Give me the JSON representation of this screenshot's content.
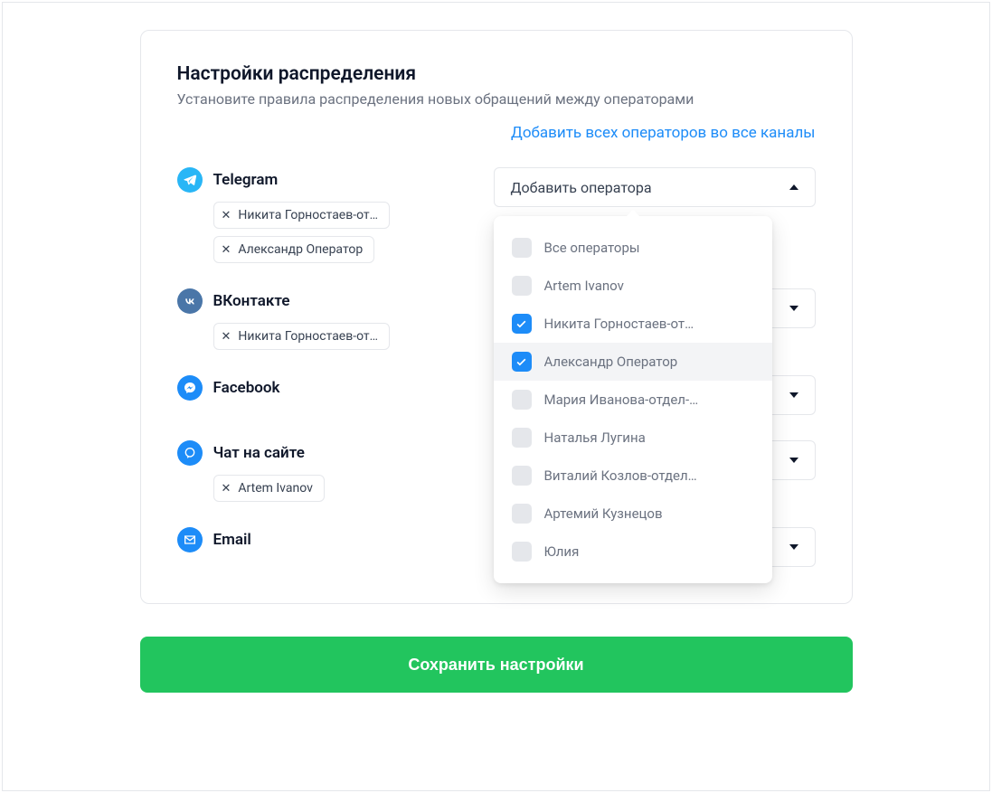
{
  "header": {
    "title": "Настройки распределения",
    "subtitle": "Установите правила распределения новых обращений между операторами",
    "add_all_link": "Добавить всех операторов во все каналы"
  },
  "select_placeholder": "Добавить оператора",
  "channels": [
    {
      "key": "telegram",
      "name": "Telegram",
      "icon": "telegram-icon",
      "dropdown_open": true,
      "operators": [
        "Никита Горностаев-от…",
        "Александр Оператор"
      ]
    },
    {
      "key": "vkontakte",
      "name": "ВКонтакте",
      "icon": "vk-icon",
      "dropdown_open": false,
      "operators": [
        "Никита Горностаев-от…"
      ]
    },
    {
      "key": "facebook",
      "name": "Facebook",
      "icon": "facebook-icon",
      "dropdown_open": false,
      "operators": []
    },
    {
      "key": "site_chat",
      "name": "Чат на сайте",
      "icon": "chat-icon",
      "dropdown_open": false,
      "operators": [
        "Artem Ivanov"
      ]
    },
    {
      "key": "email",
      "name": "Email",
      "icon": "email-icon",
      "dropdown_open": false,
      "operators": []
    }
  ],
  "dropdown": {
    "items": [
      {
        "label": "Все операторы",
        "checked": false
      },
      {
        "label": "Artem Ivanov",
        "checked": false
      },
      {
        "label": "Никита Горностаев-от…",
        "checked": true
      },
      {
        "label": "Александр Оператор",
        "checked": true,
        "hover": true
      },
      {
        "label": "Мария Иванова-отдел-…",
        "checked": false
      },
      {
        "label": "Наталья Лугина",
        "checked": false
      },
      {
        "label": "Виталий Козлов-отдел…",
        "checked": false
      },
      {
        "label": "Артемий Кузнецов",
        "checked": false
      },
      {
        "label": "Юлия",
        "checked": false
      }
    ]
  },
  "save_button": "Сохранить настройки",
  "colors": {
    "accent_blue": "#1d8cf8",
    "accent_green": "#22c55e"
  }
}
